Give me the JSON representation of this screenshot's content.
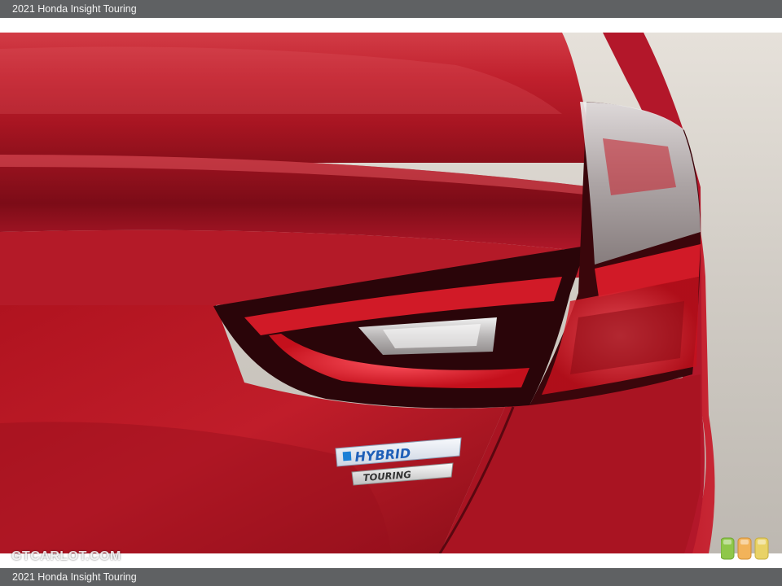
{
  "caption": {
    "text": "2021 Honda Insight Touring"
  },
  "badges": {
    "hybrid": "HYBRID",
    "touring": "TOURING"
  },
  "watermark": {
    "text": "GTCARLOT.COM"
  },
  "colors": {
    "caption_bar": "#5f6163",
    "car_paint": "#b8141f",
    "taillight_red": "#e8232e",
    "background_ground": "#c8c4bf"
  },
  "icons": {
    "site_logo": "three-stacked-bars-icon"
  }
}
